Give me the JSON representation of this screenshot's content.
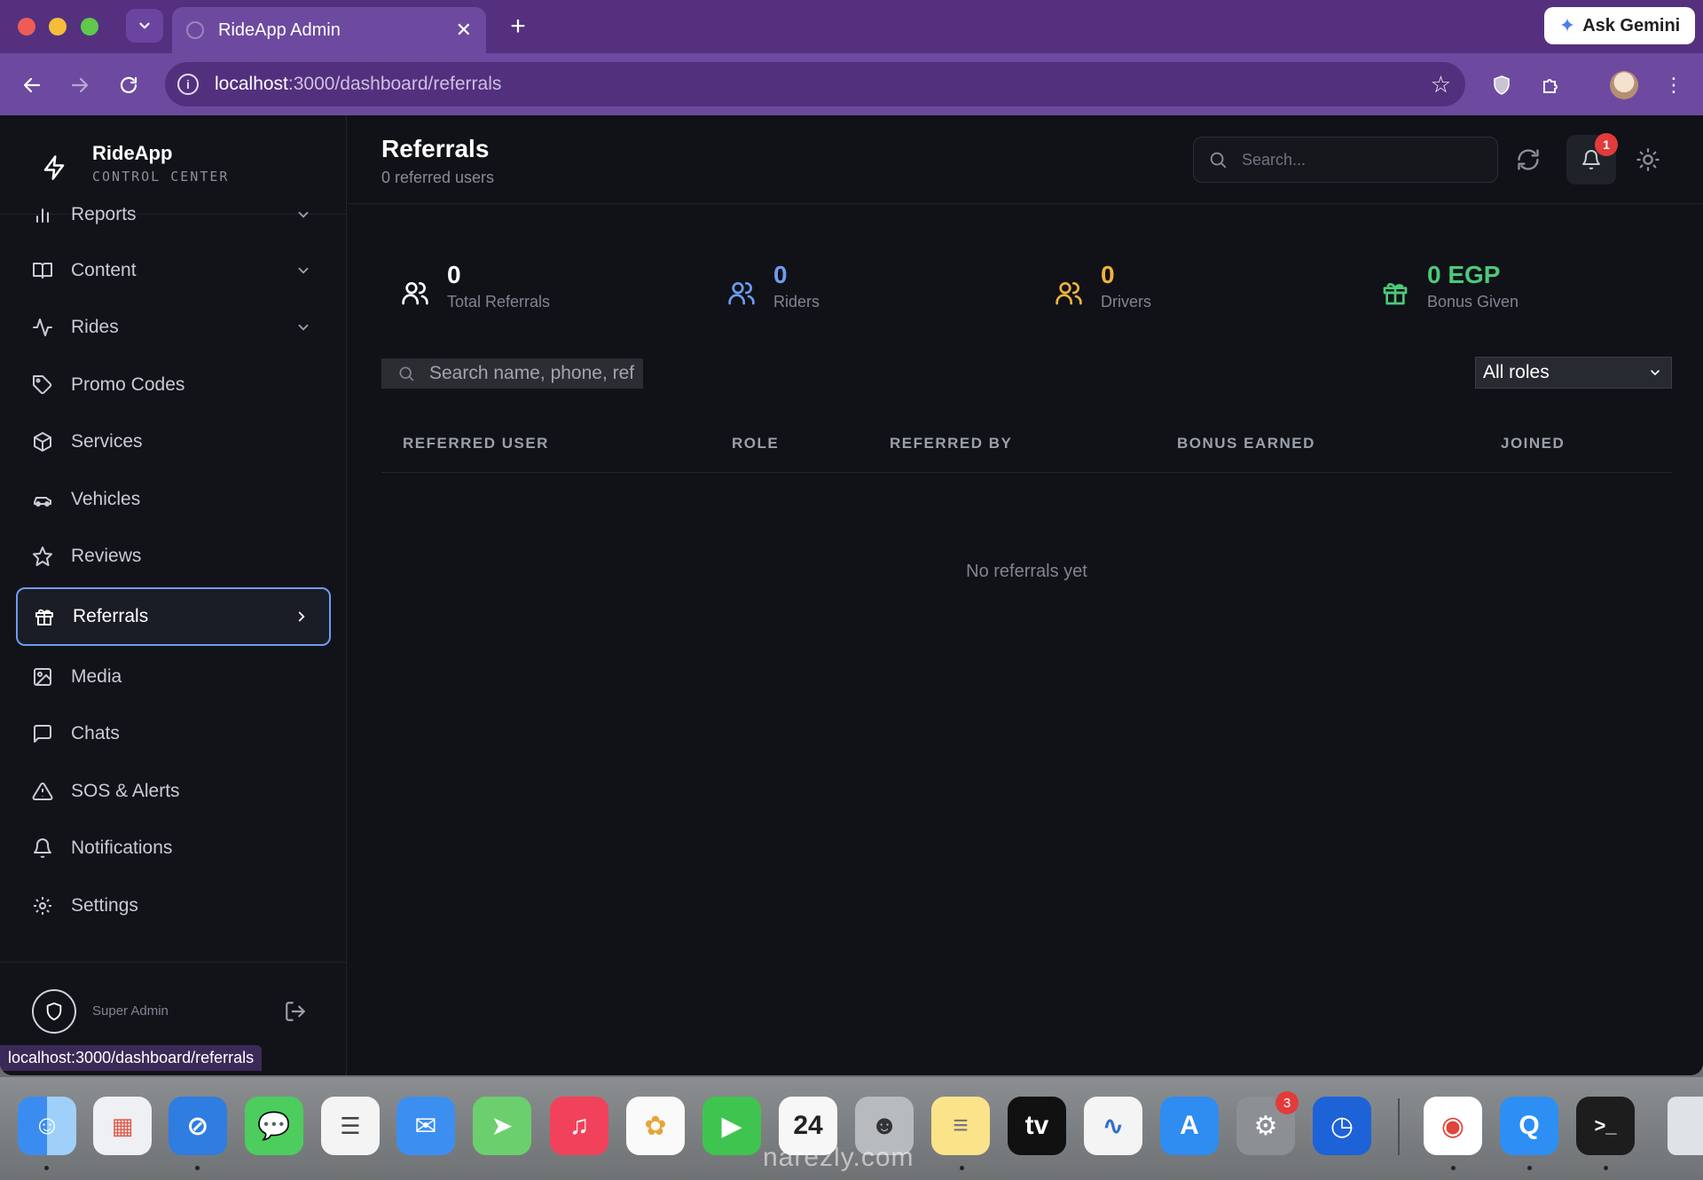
{
  "browser": {
    "tab_title": "RideApp Admin",
    "url_host": "localhost",
    "url_path": ":3000/dashboard/referrals",
    "gemini_label": "Ask Gemini",
    "status_url": "localhost:3000/dashboard/referrals"
  },
  "brand": {
    "name": "RideApp",
    "subtitle": "CONTROL CENTER"
  },
  "sidebar": {
    "items": [
      {
        "label": "Reports",
        "icon": "bar-chart-icon",
        "expandable": true
      },
      {
        "label": "Content",
        "icon": "book-icon",
        "expandable": true
      },
      {
        "label": "Rides",
        "icon": "activity-icon",
        "expandable": true
      },
      {
        "label": "Promo Codes",
        "icon": "tag-icon"
      },
      {
        "label": "Services",
        "icon": "package-icon"
      },
      {
        "label": "Vehicles",
        "icon": "car-icon"
      },
      {
        "label": "Reviews",
        "icon": "star-icon"
      },
      {
        "label": "Referrals",
        "icon": "gift-icon",
        "active": true
      },
      {
        "label": "Media",
        "icon": "image-icon"
      },
      {
        "label": "Chats",
        "icon": "message-icon"
      },
      {
        "label": "SOS & Alerts",
        "icon": "alert-triangle-icon"
      },
      {
        "label": "Notifications",
        "icon": "bell-icon"
      },
      {
        "label": "Settings",
        "icon": "settings-icon"
      }
    ],
    "user_role": "Super Admin"
  },
  "header": {
    "title": "Referrals",
    "subtitle": "0 referred users",
    "search_placeholder": "Search...",
    "notification_count": "1"
  },
  "stats": [
    {
      "value": "0",
      "label": "Total Referrals",
      "color": "#ffffff"
    },
    {
      "value": "0",
      "label": "Riders",
      "color": "#6f9bf2"
    },
    {
      "value": "0",
      "label": "Drivers",
      "color": "#f0b33a"
    },
    {
      "value": "0 EGP",
      "label": "Bonus Given",
      "color": "#4cc97a"
    }
  ],
  "filters": {
    "search_placeholder": "Search name, phone, ref",
    "role_selected": "All roles"
  },
  "table": {
    "columns": [
      "REFERRED USER",
      "ROLE",
      "REFERRED BY",
      "BONUS EARNED",
      "JOINED"
    ],
    "empty_text": "No referrals yet"
  },
  "dock": {
    "calendar_day": "24",
    "settings_badge": "3",
    "watermark": "narezly.com"
  }
}
